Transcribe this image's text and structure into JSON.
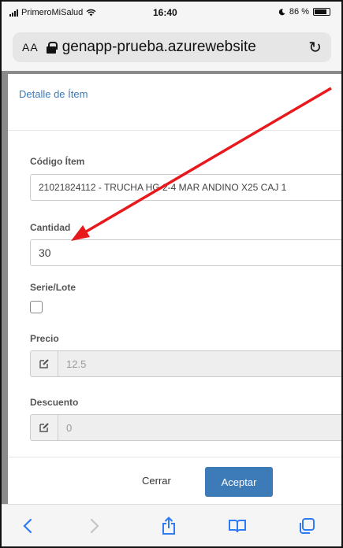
{
  "status_bar": {
    "carrier": "PrimeroMiSalud",
    "time": "16:40",
    "battery": "86 %",
    "battery_level": 0.86
  },
  "browser": {
    "aa_label": "AA",
    "url": "genapp-prueba.azurewebsite"
  },
  "modal": {
    "title": "Detalle de Ítem",
    "item_code": {
      "label": "Código Ítem",
      "value": "21021824112 - TRUCHA HG 2-4 MAR ANDINO X25 CAJ 1"
    },
    "quantity": {
      "label": "Cantidad",
      "value": "30"
    },
    "serial": {
      "label": "Serie/Lote"
    },
    "price": {
      "label": "Precio",
      "value": "12.5"
    },
    "discount": {
      "label": "Descuento",
      "value": "0"
    },
    "close_label": "Cerrar",
    "accept_label": "Aceptar"
  },
  "colors": {
    "primary": "#3d7ab8",
    "annotation_arrow": "#e8191c",
    "overlay": "#8a8a8a"
  },
  "icons": {
    "wifi": "wifi-icon",
    "lock": "lock-icon",
    "reload": "reload-icon",
    "edit": "edit-icon",
    "back": "back-icon",
    "forward": "forward-icon",
    "share": "share-icon",
    "bookmarks": "book-icon",
    "tabs": "tabs-icon"
  }
}
